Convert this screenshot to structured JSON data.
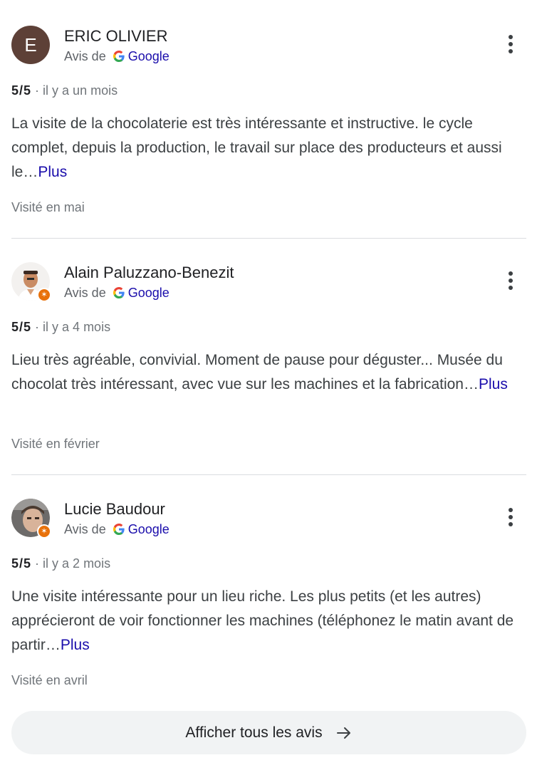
{
  "reviews": [
    {
      "avatar_letter": "E",
      "avatar_color": "#5d4037",
      "name": "ERIC OLIVIER",
      "source_prefix": "Avis de",
      "source_name": "Google",
      "rating": "5/5",
      "time": "· il y a un mois",
      "text": "La visite de la chocolaterie est très intéressante et instructive. le cycle complet, depuis la production, le travail sur place des producteurs et aussi le…",
      "more": "Plus",
      "visited": "Visité en mai"
    },
    {
      "avatar_letter": "",
      "name": "Alain Paluzzano-Benezit",
      "source_prefix": "Avis de",
      "source_name": "Google",
      "rating": "5/5",
      "time": "· il y a 4 mois",
      "text": "Lieu très agréable, convivial. Moment de pause pour déguster... Musée du chocolat très intéressant, avec vue sur les machines et la fabrication…",
      "more": "Plus",
      "visited": "Visité en février"
    },
    {
      "avatar_letter": "",
      "name": "Lucie Baudour",
      "source_prefix": "Avis de",
      "source_name": "Google",
      "rating": "5/5",
      "time": "· il y a 2 mois",
      "text": "Une visite intéressante pour un lieu riche. Les plus petits (et les autres) apprécieront de voir fonctionner les machines (téléphonez le matin avant de partir…",
      "more": "Plus",
      "visited": "Visité en avril"
    }
  ],
  "show_all_label": "Afficher tous les avis",
  "colors": {
    "link": "#1a0dab",
    "local_guide_badge": "#e8710a",
    "button_bg": "#f1f3f4"
  }
}
